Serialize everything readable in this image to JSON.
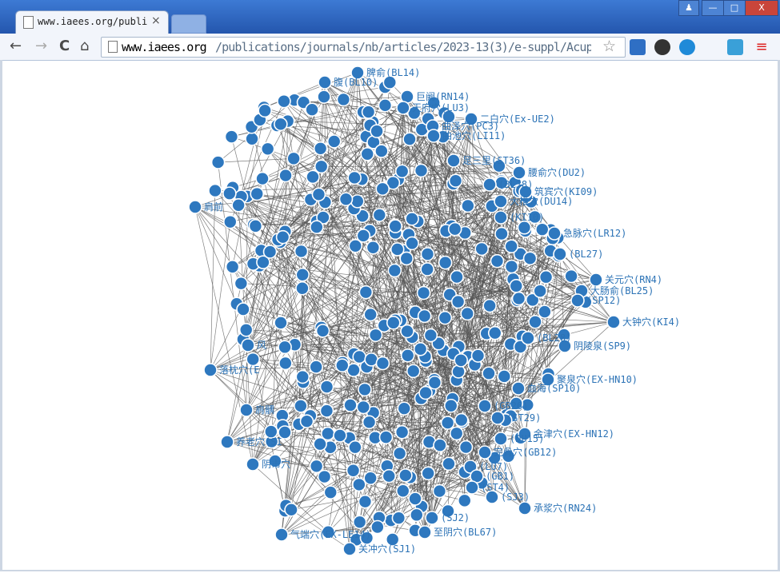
{
  "browser": {
    "tab_title": "www.iaees.org/publicati",
    "tab_close": "×",
    "url_host": "www.iaees.org",
    "url_path": "/publications/journals/nb/articles/2023-13(3)/e-suppl/AcupointF",
    "back": "←",
    "forward": "→",
    "reload": "C",
    "home": "⌂",
    "star": "☆",
    "win_user": "♟",
    "win_min": "—",
    "win_max": "□",
    "win_close": "X",
    "ext_menu": "≡"
  },
  "colors": {
    "node": "#2e78bf",
    "node_stroke": "#ffffff",
    "edge": "#555555",
    "label": "#2c73b6"
  },
  "network": {
    "labeled_nodes": [
      {
        "id": "BL14",
        "label": "脾俞(BL14)"
      },
      {
        "id": "BL10",
        "label": "腹(BL10)"
      },
      {
        "id": "RN14",
        "label": "巨阙(RN14)"
      },
      {
        "id": "LU3",
        "label": "天府穴(LU3)"
      },
      {
        "id": "EX-UE2",
        "label": "二白穴(Ex-UE2)"
      },
      {
        "id": "PC3",
        "label": "曲泽穴(PC3)"
      },
      {
        "id": "LI11",
        "label": "曲池穴(LI11)"
      },
      {
        "id": "ST36",
        "label": "足三里(ST36)"
      },
      {
        "id": "DU2",
        "label": "腰俞穴(DU2)"
      },
      {
        "id": "BL38",
        "label": "(BL38)"
      },
      {
        "id": "KI09",
        "label": "筑宾穴(KI09)"
      },
      {
        "id": "DU14",
        "label": "大椎穴(DU14)"
      },
      {
        "id": "KI10",
        "label": "(KI10)"
      },
      {
        "id": "LR12",
        "label": "急脉穴(LR12)"
      },
      {
        "id": "BL27",
        "label": "(BL27)"
      },
      {
        "id": "RN4",
        "label": "关元穴(RN4)"
      },
      {
        "id": "BL25",
        "label": "大肠俞(BL25)"
      },
      {
        "id": "SP12",
        "label": "(SP12)"
      },
      {
        "id": "KI4",
        "label": "大钟穴(KI4)"
      },
      {
        "id": "BL28",
        "label": "(BL28)"
      },
      {
        "id": "SP9",
        "label": "阴陵泉(SP9)"
      },
      {
        "id": "EX-HN10",
        "label": "聚泉穴(EX-HN10)"
      },
      {
        "id": "SP10",
        "label": "血海(SP10)"
      },
      {
        "id": "GB26",
        "label": "(GB26)"
      },
      {
        "id": "ST29",
        "label": "(ST29)"
      },
      {
        "id": "EX-HN12",
        "label": "金津穴(EX-HN12)"
      },
      {
        "id": "DU15",
        "label": "(DU15)"
      },
      {
        "id": "GB12",
        "label": "完骨穴(GB12)"
      },
      {
        "id": "LU7",
        "label": "(LU7)"
      },
      {
        "id": "GB1",
        "label": "(GB1)"
      },
      {
        "id": "ST4",
        "label": "(ST4)"
      },
      {
        "id": "SJ3",
        "label": "(SJ3)"
      },
      {
        "id": "RN24",
        "label": "承浆穴(RN24)"
      },
      {
        "id": "SJ2",
        "label": "(SJ2)"
      },
      {
        "id": "BL67",
        "label": "至阴穴(BL67)"
      },
      {
        "id": "SJ1",
        "label": "关冲穴(SJ1)"
      },
      {
        "id": "EX-LE14",
        "label": "气端穴(EX-LE14)"
      },
      {
        "id": "LI2",
        "label": "阴市穴"
      },
      {
        "id": "SI6",
        "label": "养老穴(SI"
      },
      {
        "id": "LI15",
        "label": "肩髃"
      },
      {
        "id": "EX-UE8",
        "label": "落枕穴(E"
      },
      {
        "id": "GB20",
        "label": "风"
      },
      {
        "id": "BL13",
        "label": "肩前"
      }
    ],
    "hidden_node_count": 300
  }
}
